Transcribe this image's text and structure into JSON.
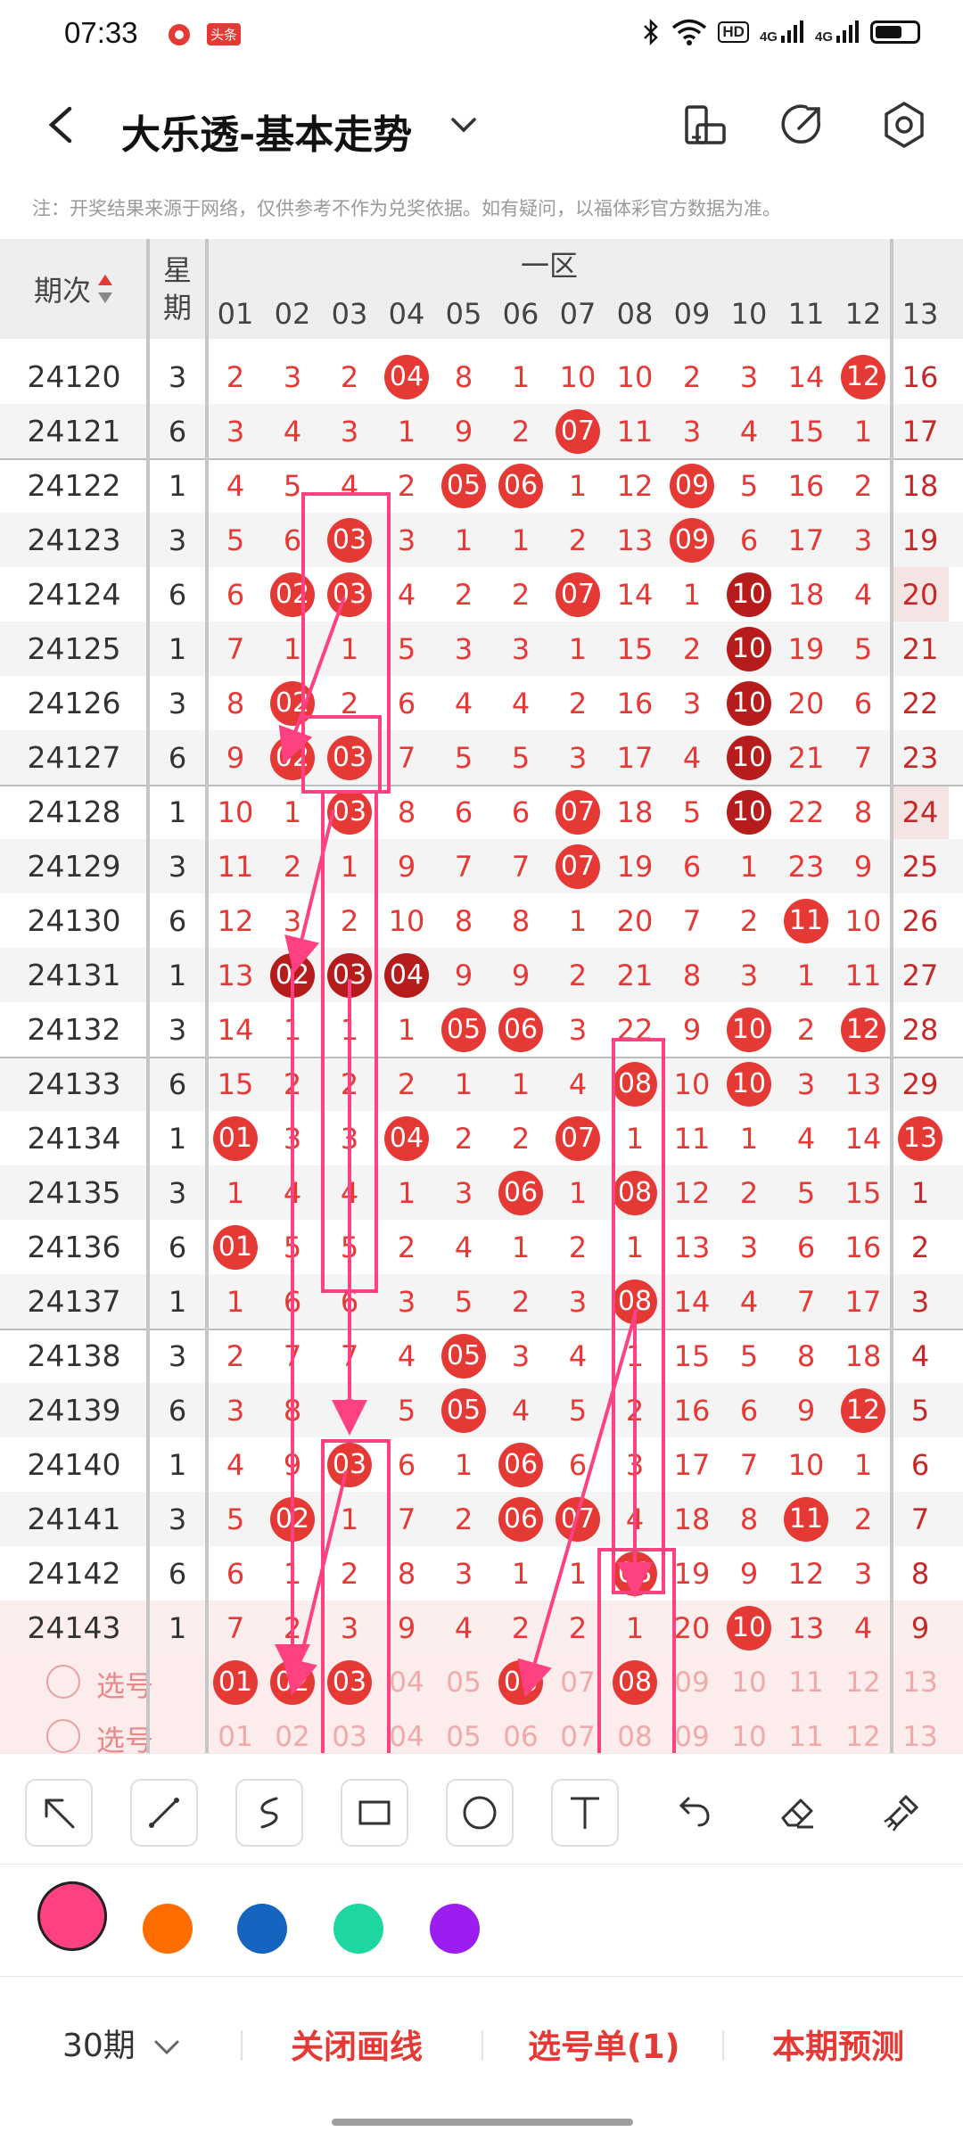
{
  "status": {
    "time": "07:33",
    "badge": "头条",
    "hd": "HD",
    "sig1": "4G",
    "sig2": "4G",
    "battery_level": 0.65
  },
  "header": {
    "title": "大乐透-基本走势"
  },
  "notice": "注：开奖结果来源于网络，仅供参考不作为兑奖依据。如有疑问，以福体彩官方数据为准。",
  "table": {
    "period_header": "期次",
    "week_header": "星期",
    "zone_header": "一区",
    "columns": [
      "01",
      "02",
      "03",
      "04",
      "05",
      "06",
      "07",
      "08",
      "09",
      "10",
      "11",
      "12",
      "13"
    ],
    "rows": [
      {
        "p": "24120",
        "w": "3",
        "c": [
          "2",
          "3",
          "2",
          "04",
          "8",
          "1",
          "10",
          "10",
          "2",
          "3",
          "14",
          "12",
          "16"
        ]
      },
      {
        "p": "24121",
        "w": "6",
        "c": [
          "3",
          "4",
          "3",
          "1",
          "9",
          "2",
          "07",
          "11",
          "3",
          "4",
          "15",
          "1",
          "17"
        ]
      },
      {
        "p": "24122",
        "w": "1",
        "c": [
          "4",
          "5",
          "4",
          "2",
          "05",
          "06",
          "1",
          "12",
          "09",
          "5",
          "16",
          "2",
          "18"
        ]
      },
      {
        "p": "24123",
        "w": "3",
        "c": [
          "5",
          "6",
          "03",
          "3",
          "1",
          "1",
          "2",
          "13",
          "09",
          "6",
          "17",
          "3",
          "19"
        ]
      },
      {
        "p": "24124",
        "w": "6",
        "c": [
          "6",
          "02",
          "03",
          "4",
          "2",
          "2",
          "07",
          "14",
          "1",
          "10",
          "18",
          "4",
          "20"
        ]
      },
      {
        "p": "24125",
        "w": "1",
        "c": [
          "7",
          "1",
          "1",
          "5",
          "3",
          "3",
          "1",
          "15",
          "2",
          "10",
          "19",
          "5",
          "21"
        ]
      },
      {
        "p": "24126",
        "w": "3",
        "c": [
          "8",
          "02",
          "2",
          "6",
          "4",
          "4",
          "2",
          "16",
          "3",
          "10",
          "20",
          "6",
          "22"
        ]
      },
      {
        "p": "24127",
        "w": "6",
        "c": [
          "9",
          "02",
          "03",
          "7",
          "5",
          "5",
          "3",
          "17",
          "4",
          "10",
          "21",
          "7",
          "23"
        ]
      },
      {
        "p": "24128",
        "w": "1",
        "c": [
          "10",
          "1",
          "03",
          "8",
          "6",
          "6",
          "07",
          "18",
          "5",
          "10",
          "22",
          "8",
          "24"
        ]
      },
      {
        "p": "24129",
        "w": "3",
        "c": [
          "11",
          "2",
          "1",
          "9",
          "7",
          "7",
          "07",
          "19",
          "6",
          "1",
          "23",
          "9",
          "25"
        ]
      },
      {
        "p": "24130",
        "w": "6",
        "c": [
          "12",
          "3",
          "2",
          "10",
          "8",
          "8",
          "1",
          "20",
          "7",
          "2",
          "11",
          "10",
          "26"
        ]
      },
      {
        "p": "24131",
        "w": "1",
        "c": [
          "13",
          "02",
          "03",
          "04",
          "9",
          "9",
          "2",
          "21",
          "8",
          "3",
          "1",
          "11",
          "27"
        ]
      },
      {
        "p": "24132",
        "w": "3",
        "c": [
          "14",
          "1",
          "1",
          "1",
          "05",
          "06",
          "3",
          "22",
          "9",
          "10",
          "2",
          "12",
          "28"
        ]
      },
      {
        "p": "24133",
        "w": "6",
        "c": [
          "15",
          "2",
          "2",
          "2",
          "1",
          "1",
          "4",
          "08",
          "10",
          "10",
          "3",
          "13",
          "29"
        ]
      },
      {
        "p": "24134",
        "w": "1",
        "c": [
          "01",
          "3",
          "3",
          "04",
          "2",
          "2",
          "07",
          "1",
          "11",
          "1",
          "4",
          "14",
          "13"
        ]
      },
      {
        "p": "24135",
        "w": "3",
        "c": [
          "1",
          "4",
          "4",
          "1",
          "3",
          "06",
          "1",
          "08",
          "12",
          "2",
          "5",
          "15",
          "1"
        ]
      },
      {
        "p": "24136",
        "w": "6",
        "c": [
          "01",
          "5",
          "5",
          "2",
          "4",
          "1",
          "2",
          "1",
          "13",
          "3",
          "6",
          "16",
          "2"
        ]
      },
      {
        "p": "24137",
        "w": "1",
        "c": [
          "1",
          "6",
          "6",
          "3",
          "5",
          "2",
          "3",
          "08",
          "14",
          "4",
          "7",
          "17",
          "3"
        ]
      },
      {
        "p": "24138",
        "w": "3",
        "c": [
          "2",
          "7",
          "7",
          "4",
          "05",
          "3",
          "4",
          "1",
          "15",
          "5",
          "8",
          "18",
          "4"
        ]
      },
      {
        "p": "24139",
        "w": "6",
        "c": [
          "3",
          "8",
          "8",
          "5",
          "05",
          "4",
          "5",
          "2",
          "16",
          "6",
          "9",
          "12",
          "5"
        ]
      },
      {
        "p": "24140",
        "w": "1",
        "c": [
          "4",
          "9",
          "03",
          "6",
          "1",
          "06",
          "6",
          "3",
          "17",
          "7",
          "10",
          "1",
          "6"
        ]
      },
      {
        "p": "24141",
        "w": "3",
        "c": [
          "5",
          "02",
          "1",
          "7",
          "2",
          "06",
          "07",
          "4",
          "18",
          "8",
          "11",
          "2",
          "7"
        ]
      },
      {
        "p": "24142",
        "w": "6",
        "c": [
          "6",
          "1",
          "2",
          "8",
          "3",
          "1",
          "1",
          "08",
          "19",
          "9",
          "12",
          "3",
          "8"
        ]
      },
      {
        "p": "24143",
        "w": "1",
        "c": [
          "7",
          "2",
          "3",
          "9",
          "4",
          "2",
          "2",
          "1",
          "20",
          "10",
          "13",
          "4",
          "9"
        ]
      }
    ],
    "select_rows": [
      {
        "label": "选号",
        "c": [
          "01",
          "02",
          "03",
          "04",
          "05",
          "06",
          "07",
          "08",
          "09",
          "10",
          "11",
          "12",
          "13"
        ]
      },
      {
        "label": "选号",
        "c": [
          "01",
          "02",
          "03",
          "04",
          "05",
          "06",
          "07",
          "08",
          "09",
          "10",
          "11",
          "12",
          "13"
        ]
      }
    ]
  },
  "toolbar": [
    "pointer-tool",
    "line-tool",
    "freehand-tool",
    "rectangle-tool",
    "circle-tool",
    "text-tool",
    "undo-tool",
    "eraser-tool",
    "clear-tool"
  ],
  "colors": [
    "#ff4081",
    "#ff6d00",
    "#1565c0",
    "#1ed6a0",
    "#9c1df0"
  ],
  "bottom": {
    "period": "30期",
    "close_draw": "关闭画线",
    "pick_list": "选号单(1)",
    "predict": "本期预测"
  }
}
